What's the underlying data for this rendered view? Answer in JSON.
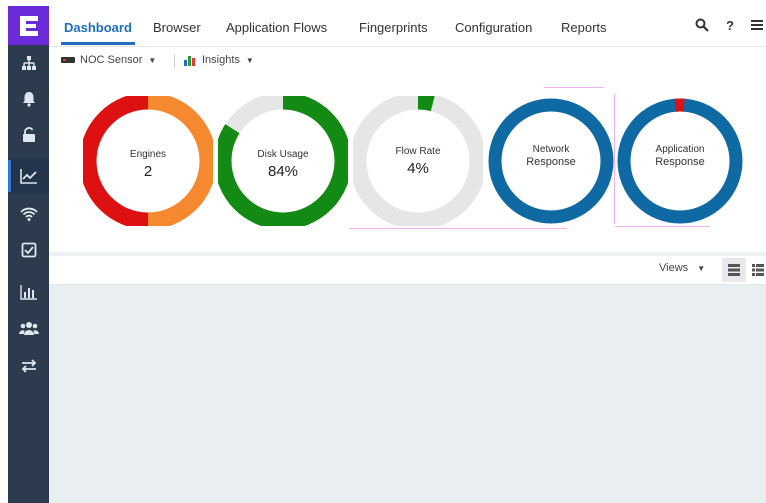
{
  "logo": {
    "icon": "brand-e-logo",
    "color": "#6c2bd9"
  },
  "sidebar": {
    "items": [
      {
        "icon": "network-topology-icon"
      },
      {
        "icon": "bell-icon"
      },
      {
        "icon": "lock-icon"
      },
      {
        "icon": "line-chart-icon",
        "active": true
      },
      {
        "icon": "wifi-icon"
      },
      {
        "icon": "checkbox-icon"
      },
      {
        "icon": "bar-chart-icon"
      },
      {
        "icon": "users-icon"
      },
      {
        "icon": "swap-arrows-icon"
      }
    ]
  },
  "tabs": [
    {
      "label": "Dashboard",
      "active": true
    },
    {
      "label": "Browser"
    },
    {
      "label": "Application Flows"
    },
    {
      "label": "Fingerprints"
    },
    {
      "label": "Configuration"
    },
    {
      "label": "Reports"
    }
  ],
  "top_icons": {
    "search": "search-icon",
    "help": "?",
    "menu": "menu-icon"
  },
  "subbar": {
    "sensor": "NOC Sensor",
    "insights": "Insights"
  },
  "gauges": [
    {
      "label": "Engines",
      "value": "2"
    },
    {
      "label": "Disk Usage",
      "value": "84%"
    },
    {
      "label": "Flow Rate",
      "value": "4%"
    },
    {
      "label": "Network",
      "label2": "Response"
    },
    {
      "label": "Application",
      "label2": "Response"
    }
  ],
  "views": {
    "label": "Views"
  },
  "colors": {
    "red": "#dd1111",
    "orange": "#f4892f",
    "green": "#138a13",
    "blue": "#0f6aa3",
    "track": "#e6e6e6",
    "sidebar": "#2c3b4e",
    "accent": "#1f6fbd"
  }
}
